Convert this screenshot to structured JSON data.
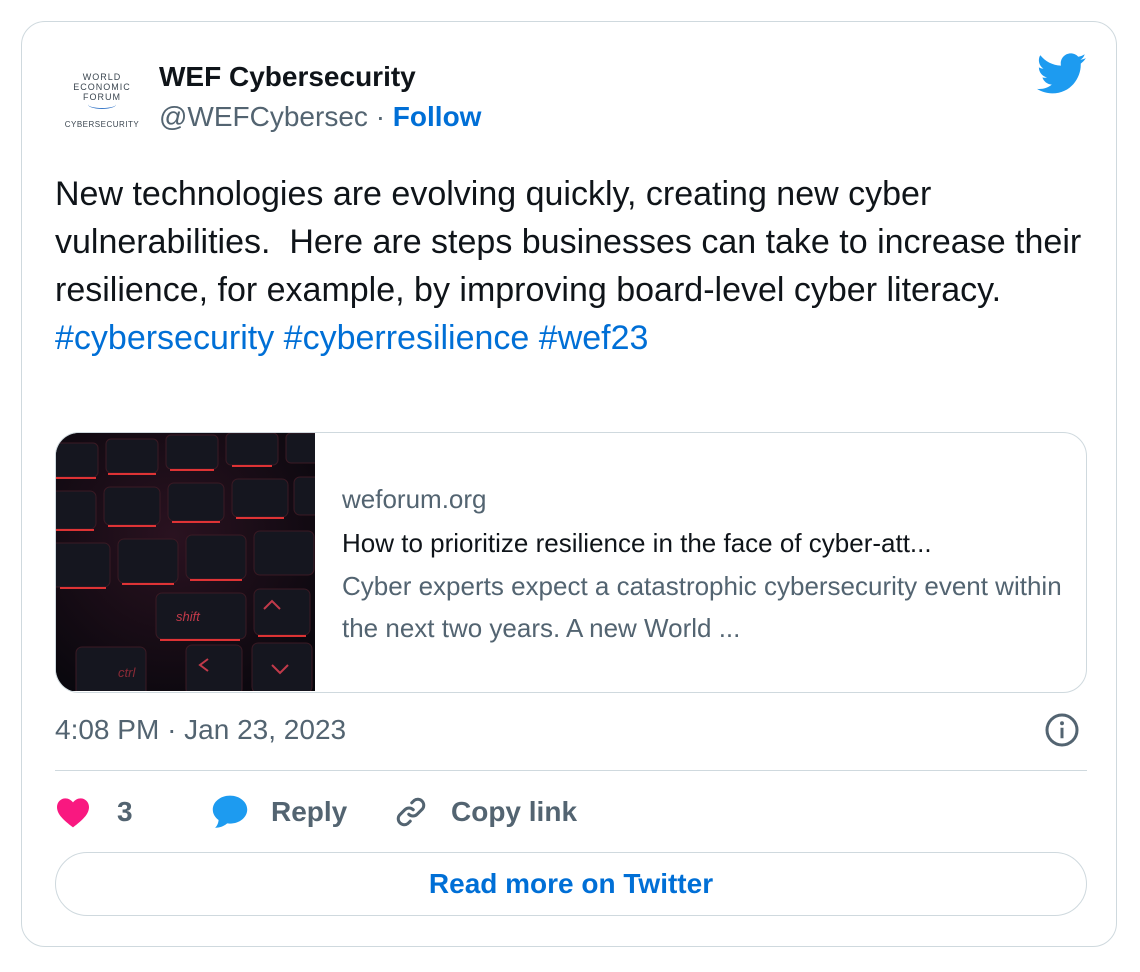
{
  "author": {
    "name": "WEF Cybersecurity",
    "handle": "@WEFCybersec",
    "separator": "·",
    "follow_label": "Follow",
    "avatar_logo": {
      "line1": "WORLD",
      "line2": "ECONOMIC",
      "line3": "FORUM",
      "line4": "CYBERSECURITY"
    }
  },
  "tweet": {
    "text": "New technologies are evolving quickly, creating new cyber vulnerabilities.  Here are steps businesses can take to increase their resilience, for example, by improving board-level cyber literacy. ",
    "hashtags": [
      "#cybersecurity",
      "#cyberresilience",
      "#wef23"
    ]
  },
  "link_card": {
    "domain": "weforum.org",
    "title": "How to prioritize resilience in the face of cyber-att...",
    "description": "Cyber experts expect a catastrophic cybersecurity event within the next two years. A new World ...",
    "image_keys": {
      "shift": "shift",
      "ctrl": "ctrl"
    }
  },
  "timestamp": {
    "time": "4:08 PM",
    "separator": "·",
    "date": "Jan 23, 2023"
  },
  "actions": {
    "like_count": "3",
    "reply_label": "Reply",
    "copy_link_label": "Copy link"
  },
  "read_more_label": "Read more on Twitter",
  "colors": {
    "link_blue": "#006fd6",
    "twitter_blue": "#1d9bf0",
    "like_pink": "#f91880",
    "secondary_text": "#536471",
    "border": "#cfd9de"
  },
  "icons": {
    "brand": "twitter-bird-icon",
    "info": "info-icon",
    "like": "heart-icon",
    "reply": "speech-bubble-icon",
    "copy": "link-icon"
  }
}
